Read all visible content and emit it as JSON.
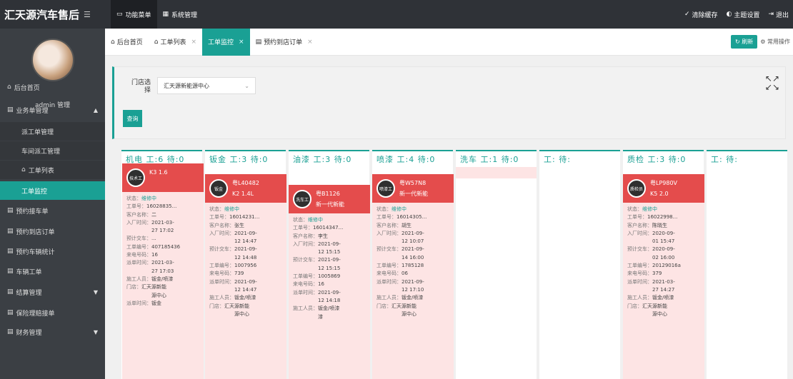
{
  "brand": {
    "title": "汇天源汽车售后",
    "menu_icon": "☰"
  },
  "topnav": [
    {
      "label": "功能菜单",
      "icon": "monitor-icon"
    },
    {
      "label": "系统管理",
      "icon": "grid-icon"
    }
  ],
  "topright": [
    {
      "label": "清除缓存",
      "icon": "broom-icon"
    },
    {
      "label": "主题设置",
      "icon": "palette-icon"
    },
    {
      "label": "退出",
      "icon": "logout-icon"
    }
  ],
  "sidebar": {
    "username": "admin 管理",
    "items": [
      {
        "label": "后台首页",
        "icon": "home-icon"
      },
      {
        "label": "业务单管理",
        "icon": "doc-icon",
        "arrow": "▲"
      },
      {
        "label": "派工单管理",
        "icon": ""
      },
      {
        "label": "车间派工管理",
        "icon": ""
      },
      {
        "label": "工单列表",
        "icon": "home-icon"
      },
      {
        "label": "工单监控",
        "icon": ""
      },
      {
        "label": "预约接车单",
        "icon": "doc-icon"
      },
      {
        "label": "预约到店订单",
        "icon": "doc-icon"
      },
      {
        "label": "预约车辆统计",
        "icon": "doc-icon"
      },
      {
        "label": "车辆工单",
        "icon": "doc-icon"
      },
      {
        "label": "结算管理",
        "icon": "doc-icon",
        "arrow": "▼"
      },
      {
        "label": "保险理赔接单",
        "icon": "doc-icon"
      },
      {
        "label": "财务管理",
        "icon": "doc-icon",
        "arrow": "▼"
      }
    ]
  },
  "tabs": [
    {
      "label": "后台首页",
      "icon": "home-icon",
      "closable": false
    },
    {
      "label": "工单列表",
      "icon": "home-icon",
      "closable": true
    },
    {
      "label": "工单监控",
      "icon": "",
      "closable": true
    },
    {
      "label": "预约到店订单",
      "icon": "doc-icon",
      "closable": true
    }
  ],
  "tabright": {
    "refresh": "刷新",
    "options": "常用操作"
  },
  "filter": {
    "label": "门店选择",
    "selected": "汇天源新能源中心",
    "search": "查询",
    "expand_icon": "↖ ↗\n↙ ↘"
  },
  "columns": [
    {
      "label": "机电 工:6 待:0"
    },
    {
      "label": "钣金 工:3 待:0"
    },
    {
      "label": "油漆 工:3 待:0"
    },
    {
      "label": "喷漆 工:4 待:0"
    },
    {
      "label": "洗车 工:1 待:0"
    },
    {
      "label": "工: 待:"
    },
    {
      "label": "质检 工:3 待:0"
    },
    {
      "label": "工: 待:"
    }
  ],
  "cards": [
    {
      "avatar": "技术工",
      "plate": "",
      "model": "K3 1.6",
      "rows": [
        [
          "状态",
          "维修中"
        ],
        [
          "工单号",
          "16028835..."
        ],
        [
          "客户名称",
          "二"
        ],
        [
          "入厂时间",
          "2021-03-"
        ],
        [
          "",
          "27 17:02"
        ],
        [
          "预计交车",
          "..."
        ],
        [
          "工单编号",
          "407185436"
        ],
        [
          "来电号码",
          "16"
        ],
        [
          "派单时间",
          "2021-03-"
        ],
        [
          "",
          "27 17:03"
        ],
        [
          "施工人员",
          "钣金/喷漆"
        ],
        [
          "门店",
          "汇天源新能"
        ],
        [
          "",
          "源中心"
        ],
        [
          "派单时间",
          "钣金"
        ]
      ]
    },
    {
      "avatar": "钣金",
      "plate": "粤L40482",
      "model": "K2 1.4L",
      "rows": [
        [
          "状态",
          "维修中"
        ],
        [
          "工单号",
          "16014231..."
        ],
        [
          "客户名称",
          "张生"
        ],
        [
          "入厂时间",
          "2021-09-"
        ],
        [
          "",
          "12 14:47"
        ],
        [
          "预计交车",
          "2021-09-"
        ],
        [
          "",
          "12 14:48"
        ],
        [
          "工单编号",
          "1007956"
        ],
        [
          "来电号码",
          "739"
        ],
        [
          "派单时间",
          "2021-09-"
        ],
        [
          "",
          "12 14:47"
        ],
        [
          "施工人员",
          "钣金/喷漆"
        ],
        [
          "门店",
          "汇天源新能"
        ],
        [
          "",
          "源中心"
        ]
      ]
    },
    {
      "avatar": "洗车工",
      "plate": "粤B1126",
      "model": "新一代新能",
      "rows": [
        [
          "状态",
          "维修中"
        ],
        [
          "工单号",
          "16014347..."
        ],
        [
          "客户名称",
          "李生"
        ],
        [
          "入厂时间",
          "2021-09-"
        ],
        [
          "",
          "12 15:15"
        ],
        [
          "预计交车",
          "2021-09-"
        ],
        [
          "",
          "12 15:15"
        ],
        [
          "工单编号",
          "1005869"
        ],
        [
          "来电号码",
          "16"
        ],
        [
          "派单时间",
          "2021-09-"
        ],
        [
          "",
          "12 14:18"
        ],
        [
          "施工人员",
          "钣金/喷漆"
        ],
        [
          "",
          "漆"
        ]
      ]
    },
    {
      "avatar": "喷漆工",
      "plate": "粤W57N8",
      "model": "新一代新能",
      "rows": [
        [
          "状态",
          "维修中"
        ],
        [
          "工单号",
          "16014305..."
        ],
        [
          "客户名称",
          "胡生"
        ],
        [
          "入厂时间",
          "2021-09-"
        ],
        [
          "",
          "12 10:07"
        ],
        [
          "预计交车",
          "2021-09-"
        ],
        [
          "",
          "14 16:00"
        ],
        [
          "工单编号",
          "1785128"
        ],
        [
          "来电号码",
          "06"
        ],
        [
          "派单时间",
          "2021-09-"
        ],
        [
          "",
          "12 17:10"
        ],
        [
          "施工人员",
          "钣金/喷漆"
        ],
        [
          "门店",
          "汇天源新能"
        ],
        [
          "",
          "源中心"
        ]
      ]
    },
    {
      "avatar": "质检员",
      "plate": "粤LP980V",
      "model": "K5 2.0",
      "rows": [
        [
          "状态",
          "维修中"
        ],
        [
          "工单号",
          "16022998..."
        ],
        [
          "客户名称",
          "陈晓生"
        ],
        [
          "入厂时间",
          "2020-09-"
        ],
        [
          "",
          "01 15:47"
        ],
        [
          "预计交车",
          "2020-09-"
        ],
        [
          "",
          "02 16:00"
        ],
        [
          "工单编号",
          "20129016a"
        ],
        [
          "来电号码",
          "379"
        ],
        [
          "派单时间",
          "2021-03-"
        ],
        [
          "",
          "27 14:27"
        ],
        [
          "施工人员",
          "钣金/喷漆"
        ],
        [
          "门店",
          "汇天源新能"
        ],
        [
          "",
          "源中心"
        ]
      ]
    }
  ],
  "colors": {
    "accent": "#1aa094",
    "topbar": "#2f3237",
    "sidebar": "#3b3f44",
    "card_header": "#e44c4c",
    "card_body": "#fde4e4"
  }
}
